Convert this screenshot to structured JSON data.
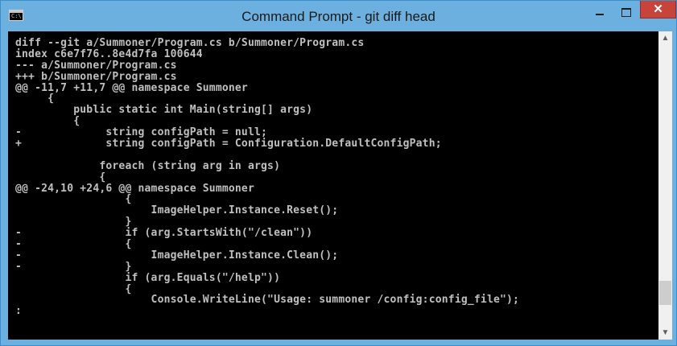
{
  "window": {
    "title": "Command Prompt - git  diff head",
    "icon_glyph": "C:\\"
  },
  "console": {
    "lines": [
      "diff --git a/Summoner/Program.cs b/Summoner/Program.cs",
      "index c6e7f76..8e4d7fa 100644",
      "--- a/Summoner/Program.cs",
      "+++ b/Summoner/Program.cs",
      "@@ -11,7 +11,7 @@ namespace Summoner",
      "     {",
      "         public static int Main(string[] args)",
      "         {",
      "-             string configPath = null;",
      "+             string configPath = Configuration.DefaultConfigPath;",
      "",
      "             foreach (string arg in args)",
      "             {",
      "@@ -24,10 +24,6 @@ namespace Summoner",
      "                 {",
      "                     ImageHelper.Instance.Reset();",
      "                 }",
      "-                if (arg.StartsWith(\"/clean\"))",
      "-                {",
      "-                    ImageHelper.Instance.Clean();",
      "-                }",
      "                 if (arg.Equals(\"/help\"))",
      "                 {",
      "                     Console.WriteLine(\"Usage: summoner /config:config_file\");",
      ":"
    ]
  },
  "colors": {
    "titlebar": "#6bb0df",
    "console_bg": "#000000",
    "console_text": "#c0c0c0",
    "close_button": "#c7443a"
  }
}
